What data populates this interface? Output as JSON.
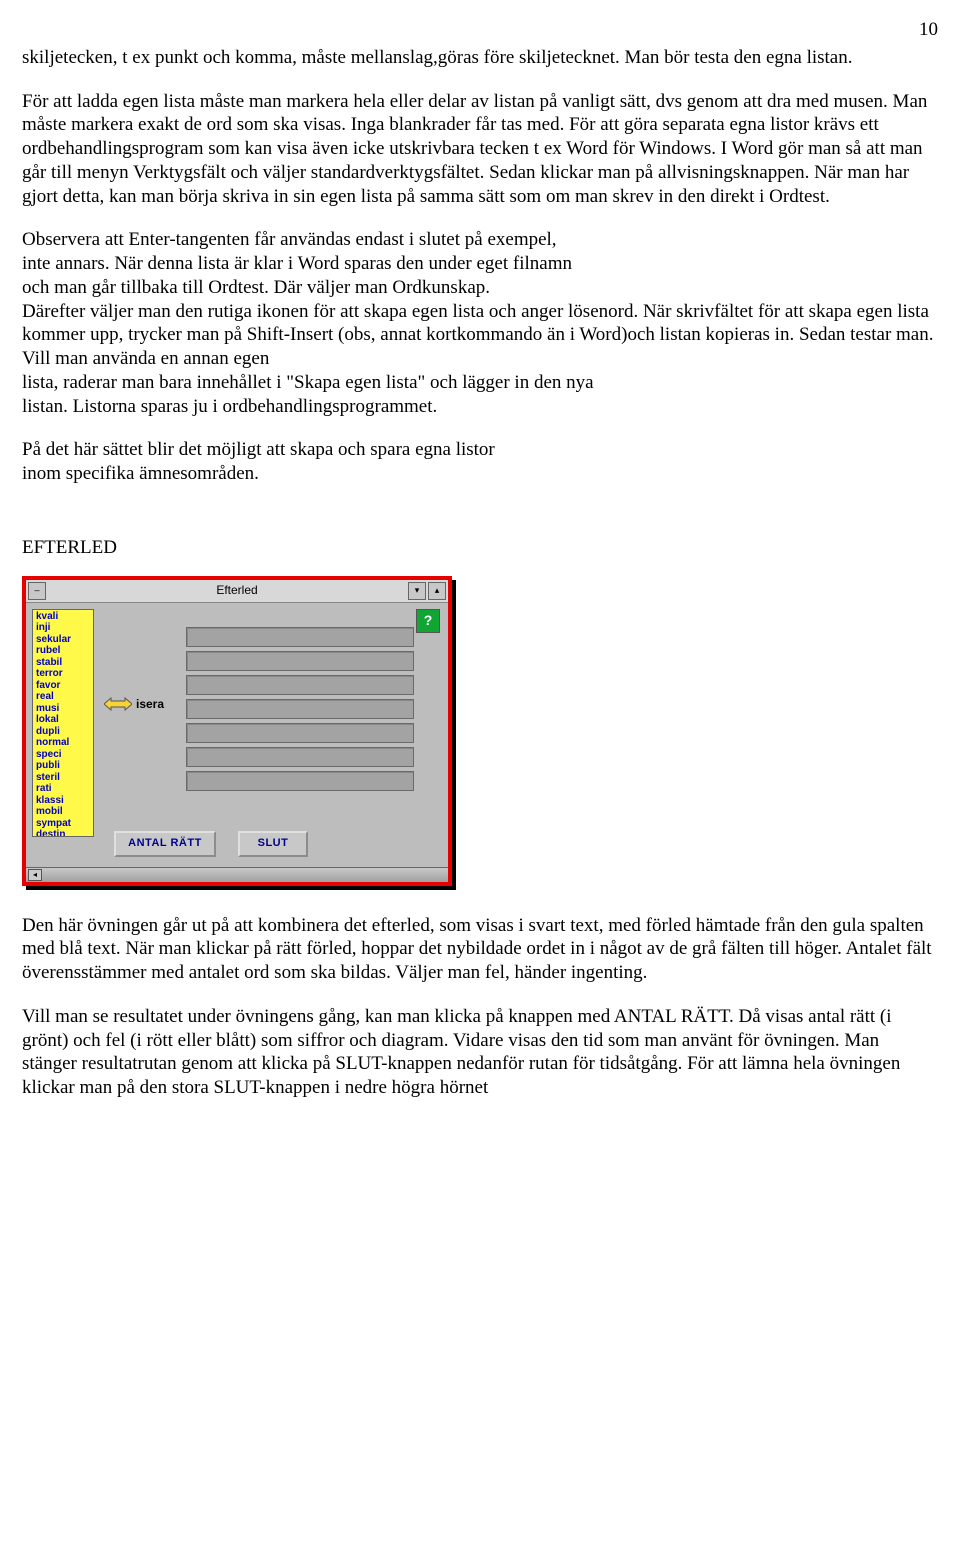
{
  "pageNumber": "10",
  "para1": "skiljetecken, t ex punkt och komma, måste mellanslag,göras före skiljetecknet. Man bör testa den egna listan.",
  "para2": "För att ladda egen lista måste man markera hela eller delar av listan på vanligt sätt, dvs genom att dra med musen. Man måste markera exakt de ord som ska visas. Inga blankrader får tas med. För att göra separata egna listor krävs ett ordbehandlingsprogram som kan visa även icke utskrivbara tecken t ex Word för Windows. I Word gör man så att man går till menyn Verktygsfält och väljer standardverktygsfältet. Sedan klickar man på allvisningsknappen. När man har gjort detta, kan man börja skriva in sin egen lista på samma sätt som om man skrev in den direkt i Ordtest.",
  "para3": "Observera att Enter-tangenten får användas endast i slutet på exempel,\ninte annars. När denna lista är klar i Word sparas den under eget filnamn\noch man går tillbaka till Ordtest. Där väljer man Ordkunskap.\nDärefter väljer man den rutiga ikonen för att skapa egen lista och anger lösenord. När skrivfältet för att skapa egen lista kommer upp, trycker man på Shift-Insert (obs, annat kortkommando än i Word)och listan kopieras in. Sedan testar man. Vill man använda en annan egen\nlista, raderar man bara innehållet i \"Skapa egen lista\" och lägger in den nya\nlistan. Listorna sparas ju i ordbehandlingsprogrammet.",
  "para4": "På det här sättet blir det möjligt att skapa och spara egna listor\ninom specifika ämnesområden.",
  "sectionTitle": "EFTERLED",
  "figure": {
    "title": "Efterled",
    "helpLabel": "?",
    "listItems": [
      "kvali",
      "inji",
      "sekular",
      "rubel",
      "stabil",
      "terror",
      "favor",
      "real",
      "musi",
      "lokal",
      "dupli",
      "normal",
      "speci",
      "publi",
      "steril",
      "rati",
      "klassi",
      "mobil",
      "sympat",
      "destin"
    ],
    "arrowLabel": "isera",
    "btnAntal": "ANTAL RÄTT",
    "btnSlut": "SLUT"
  },
  "para5": "Den här övningen går ut på att kombinera det efterled, som visas i svart text, med förled hämtade från den gula spalten med blå text. När man klickar på rätt förled, hoppar det nybildade ordet in i något av de grå fälten till höger. Antalet fält överensstämmer med antalet ord som ska bildas. Väljer man fel, händer ingenting.",
  "para6": "Vill man se resultatet under övningens gång, kan man klicka på knappen med ANTAL RÄTT. Då visas antal rätt (i grönt) och fel (i rött eller blått) som siffror och diagram. Vidare visas den tid som man använt för övningen. Man stänger resultatrutan genom att klicka på SLUT-knappen nedanför rutan för tidsåtgång. För att lämna hela övningen klickar man på den stora SLUT-knappen i nedre högra hörnet"
}
